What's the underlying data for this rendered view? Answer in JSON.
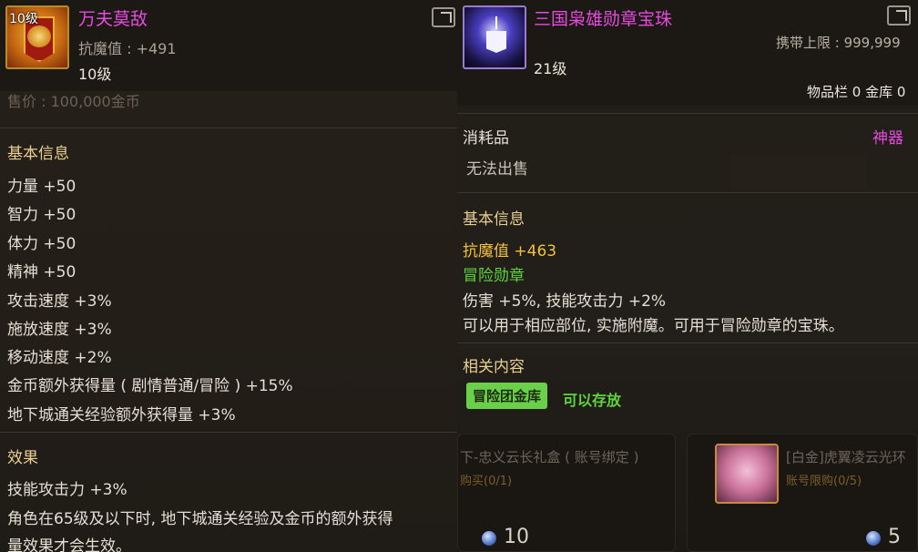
{
  "left_item": {
    "level_badge": "10级",
    "name": "万夫莫敌",
    "resist_label": "抗魔值 : +491",
    "level": "10级",
    "faded_price": "售价 : 100,000金币",
    "section_basic": "基本信息",
    "stats": [
      "力量 +50",
      "智力 +50",
      "体力 +50",
      "精神 +50",
      "攻击速度 +3%",
      "施放速度 +3%",
      "移动速度 +2%",
      "金币额外获得量 ( 剧情普通/冒险 ) +15%",
      "地下城通关经验额外获得量 +3%"
    ],
    "section_effect": "效果",
    "effects": [
      "技能攻击力 +3%",
      "角色在65级及以下时, 地下城通关经验及金币的额外获得",
      "量效果才会生效。"
    ]
  },
  "right_item": {
    "name": "三国枭雄勋章宝珠",
    "carry_limit": "携带上限 : 999,999",
    "level": "21级",
    "storage": "物品栏 0 金库 0",
    "type": "消耗品",
    "rarity": "神器",
    "sell": "无法出售",
    "section_basic": "基本信息",
    "resist": "抗魔值 +463",
    "medal_type": "冒险勋章",
    "stat_line": "伤害 +5%, 技能攻击力 +2%",
    "desc": "可以用于相应部位, 实施附魔。可用于冒险勋章的宝珠。",
    "section_related": "相关内容",
    "tag_button": "冒险团金库",
    "tag_status": "可以存放"
  },
  "background_cards": {
    "card1_title": "下-忠义云长礼盒 ( 账号绑定 )",
    "card1_sub": "购买(0/1)",
    "card1_price": "10",
    "card2_title": "[白金]虎翼凌云光环",
    "card2_sub": "账号限购(0/5)",
    "card2_price": "5"
  },
  "colors": {
    "title_purple": "#e64be0",
    "section_gold": "#e8cf92",
    "resist_yellow": "#f2c23a",
    "medal_green": "#5ed63a",
    "tag_green": "#6ad04a"
  }
}
